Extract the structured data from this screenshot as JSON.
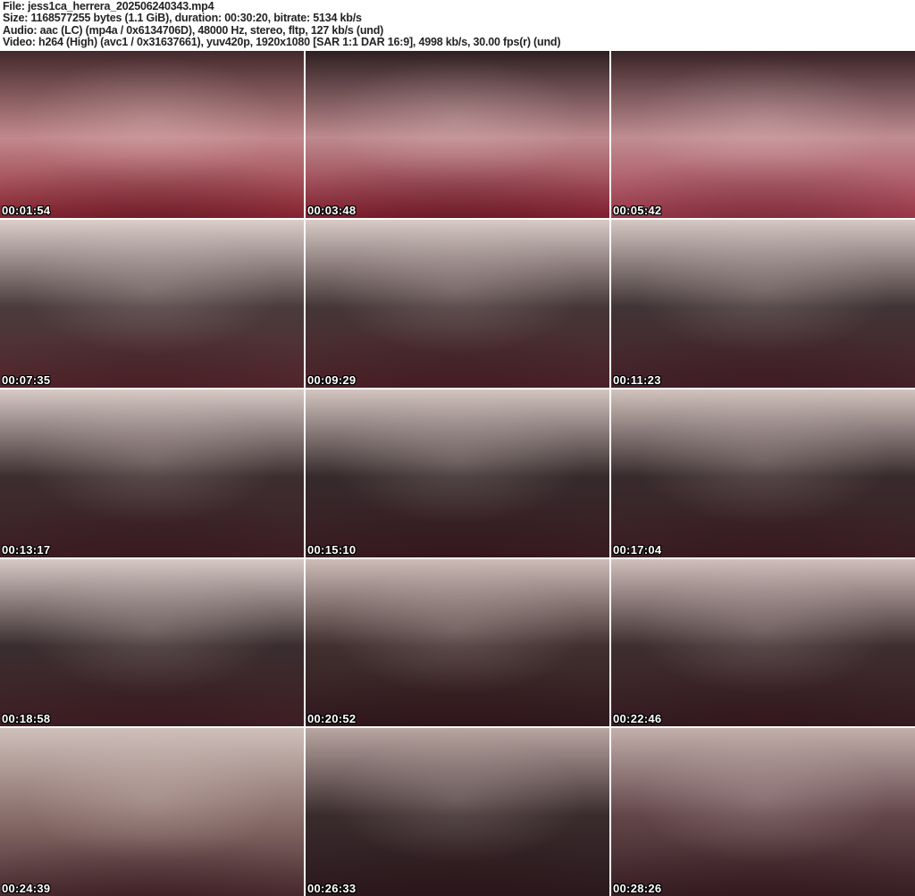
{
  "header": {
    "background": "#ffffff",
    "text_color": "#232323",
    "lines": [
      "File: jess1ca_herrera_202506240343.mp4",
      "Size: 1168577255 bytes (1.1 GiB), duration: 00:30:20, bitrate: 5134 kb/s",
      "Audio: aac (LC) (mp4a / 0x6134706D), 48000 Hz, stereo, fltp, 127 kb/s (und)",
      "Video: h264 (High) (avc1 / 0x31637661), yuv420p, 1920x1080 [SAR 1:1 DAR 16:9], 4998 kb/s, 30.00 fps(r) (und)"
    ]
  },
  "grid": {
    "columns": 3,
    "rows": 5,
    "timestamp_color": "#ffffff",
    "timestamp_outline_color": "#000000",
    "thumbnails": [
      {
        "timestamp": "00:01:54",
        "colors": [
          "#43282b",
          "#c2898d",
          "#8e2433"
        ]
      },
      {
        "timestamp": "00:03:48",
        "colors": [
          "#2e1f21",
          "#bd8a8e",
          "#8a2031"
        ]
      },
      {
        "timestamp": "00:05:42",
        "colors": [
          "#382326",
          "#c08d92",
          "#a43a4d"
        ]
      },
      {
        "timestamp": "00:07:35",
        "colors": [
          "#dccfca",
          "#4a3c3e",
          "#55272d"
        ]
      },
      {
        "timestamp": "00:09:29",
        "colors": [
          "#d9cbc6",
          "#453638",
          "#4e2329"
        ]
      },
      {
        "timestamp": "00:11:23",
        "colors": [
          "#d6c8c3",
          "#413436",
          "#47222a"
        ]
      },
      {
        "timestamp": "00:13:17",
        "colors": [
          "#d8cac5",
          "#3c2e30",
          "#3f1f26"
        ]
      },
      {
        "timestamp": "00:15:10",
        "colors": [
          "#d4c5c0",
          "#362a2c",
          "#3a1d23"
        ]
      },
      {
        "timestamp": "00:17:04",
        "colors": [
          "#d2c3be",
          "#382b2d",
          "#3d1f25"
        ]
      },
      {
        "timestamp": "00:18:58",
        "colors": [
          "#d7c9c4",
          "#3a2d2f",
          "#402026"
        ]
      },
      {
        "timestamp": "00:20:52",
        "colors": [
          "#cdbcb8",
          "#41302f",
          "#31191e"
        ]
      },
      {
        "timestamp": "00:22:46",
        "colors": [
          "#d0bfbb",
          "#3e2e30",
          "#371c22"
        ]
      },
      {
        "timestamp": "00:24:39",
        "colors": [
          "#cfc0bb",
          "#8a6f6b",
          "#4a2c30"
        ]
      },
      {
        "timestamp": "00:26:33",
        "colors": [
          "#b9a6a2",
          "#3a2b2d",
          "#2b1a1e"
        ]
      },
      {
        "timestamp": "00:28:26",
        "colors": [
          "#c2afab",
          "#63464a",
          "#382025"
        ]
      }
    ]
  }
}
